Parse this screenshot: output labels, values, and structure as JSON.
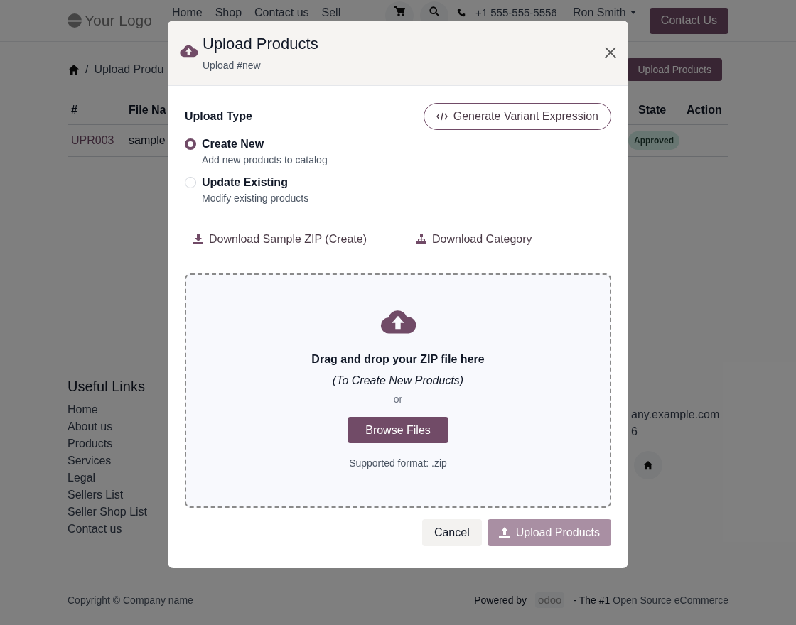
{
  "header": {
    "logo": "Your Logo",
    "nav": [
      "Home",
      "Shop",
      "Contact us",
      "Sell"
    ],
    "phone": "+1 555-555-5556",
    "user": "Ron Smith",
    "contact_button": "Contact Us"
  },
  "breadcrumb": {
    "separator": "/",
    "current": "Upload Produ"
  },
  "upload_button": "Upload Products",
  "table": {
    "columns": [
      "#",
      "File Na",
      "State",
      "Action"
    ],
    "rows": [
      {
        "number": "UPR003",
        "file": "sample",
        "state": "Approved"
      }
    ]
  },
  "footer": {
    "heading": "Useful Links",
    "links": [
      "Home",
      "About us",
      "Products",
      "Services",
      "Legal",
      "Sellers List",
      "Seller Shop List",
      "Contact us"
    ],
    "contact": [
      "any.example.com",
      "6"
    ]
  },
  "bottom": {
    "copyright": "Copyright © Company name",
    "powered_by": "Powered by",
    "brand": "odoo",
    "tagline_prefix": "- The #1",
    "tagline_link": "Open Source eCommerce"
  },
  "modal": {
    "title": "Upload Products",
    "subtitle": "Upload #new",
    "section_label": "Upload Type",
    "variant_button": "Generate Variant Expression",
    "options": [
      {
        "label": "Create New",
        "description": "Add new products to catalog",
        "selected": true
      },
      {
        "label": "Update Existing",
        "description": "Modify existing products",
        "selected": false
      }
    ],
    "links": [
      {
        "label": "Download Sample ZIP (Create)",
        "kind": "download"
      },
      {
        "label": "Download Category",
        "kind": "sitemap"
      }
    ],
    "dropzone": {
      "title": "Drag and drop your ZIP file here",
      "subtitle": "(To Create New Products)",
      "or": "or",
      "browse": "Browse Files",
      "hint": "Supported format: .zip"
    },
    "cancel": "Cancel",
    "submit": {
      "label": "Upload Products",
      "disabled": true
    }
  }
}
